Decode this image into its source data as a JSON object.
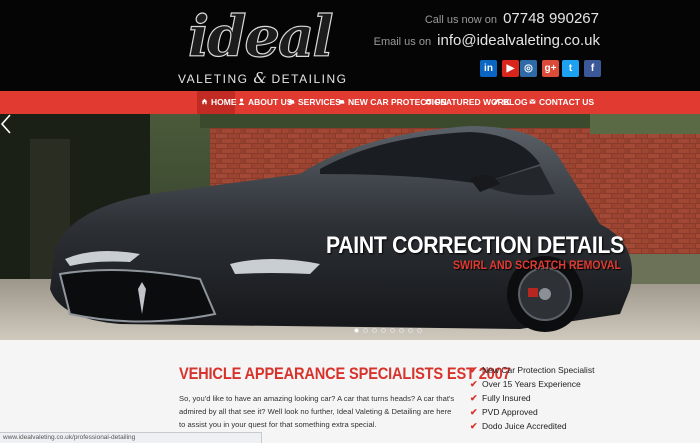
{
  "header": {
    "logo_word": "ideal",
    "logo_sub_left": "VALETING",
    "logo_sub_amp": "&",
    "logo_sub_right": "DETAILING",
    "phone_label": "Call us now on",
    "phone": "07748 990267",
    "email_label": "Email us on",
    "email": "info@idealvaleting.co.uk"
  },
  "socials": [
    {
      "name": "linkedin-icon",
      "glyph": "in",
      "color": "#0a66c2"
    },
    {
      "name": "youtube-icon",
      "glyph": "▶",
      "color": "#d9261c"
    },
    {
      "name": "instagram-icon",
      "glyph": "◎",
      "color": "#2e6aa8"
    },
    {
      "name": "google-plus-icon",
      "glyph": "g+",
      "color": "#dc4a38"
    },
    {
      "name": "twitter-icon",
      "glyph": "t",
      "color": "#1da1f2"
    },
    {
      "name": "facebook-icon",
      "glyph": "f",
      "color": "#3b5998"
    }
  ],
  "nav": {
    "home": "HOME",
    "about": "ABOUT US",
    "services": "SERVICES",
    "new_car": "NEW CAR PROTECTION",
    "featured": "FEATURED WORK",
    "blog": "BLOG",
    "contact": "CONTACT US"
  },
  "hero": {
    "title": "PAINT CORRECTION DETAILS",
    "subtitle": "SWIRL AND SCRATCH REMOVAL",
    "slide_count": 8,
    "active_slide": 1
  },
  "intro": {
    "title": "VEHICLE APPEARANCE SPECIALISTS EST 2007",
    "text": "So, you'd like to have an amazing looking car? A car that turns heads? A car that's admired by all that see it? Well look no further, Ideal Valeting & Detailing are here to assist you in your quest for that something extra special."
  },
  "features": [
    "New Car Protection Specialist",
    "Over 15 Years Experience",
    "Fully Insured",
    "PVD Approved",
    "Dodo Juice Accredited"
  ],
  "status_url": "www.idealvaleting.co.uk/professional-detailing",
  "colors": {
    "accent_red": "#e13a31",
    "header_bg": "#050505"
  }
}
